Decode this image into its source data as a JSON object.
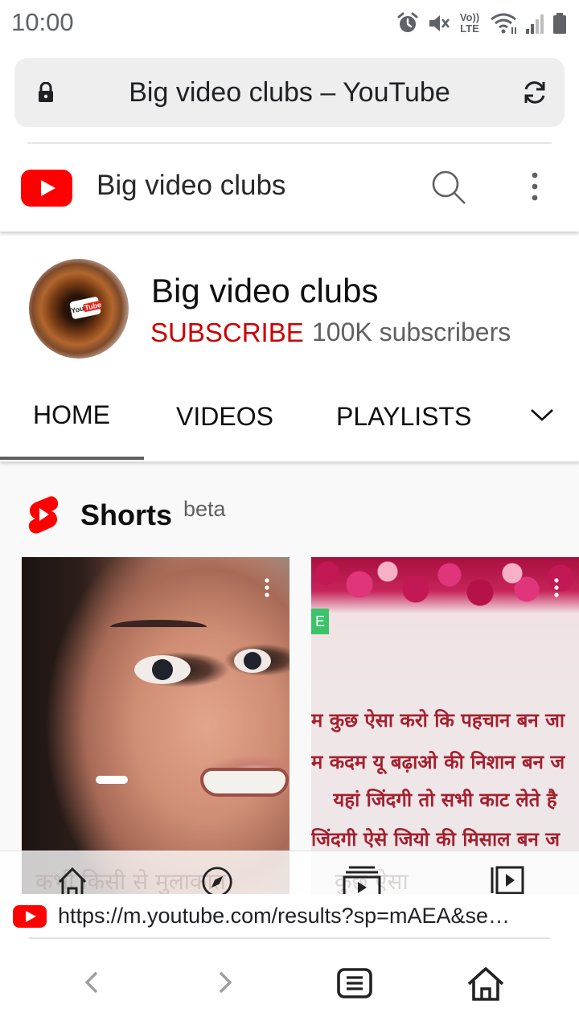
{
  "status_bar": {
    "time": "10:00",
    "lte_label_top": "Vo))",
    "lte_label_bottom": "LTE",
    "icons": [
      "alarm-icon",
      "mute-icon",
      "volte-icon",
      "wifi-icon",
      "signal-icon",
      "battery-icon"
    ]
  },
  "browser": {
    "tab_title": "Big video clubs – YouTube",
    "suggestion_url": "https://m.youtube.com/results?sp=mAEA&se…"
  },
  "header": {
    "channel_title": "Big video clubs"
  },
  "channel": {
    "name": "Big video clubs",
    "subscribe_label": "SUBSCRIBE",
    "subscribers": "100K subscribers",
    "avatar_logo_text": "You",
    "avatar_logo_tube": "Tube"
  },
  "tabs": [
    {
      "label": "HOME",
      "selected": true
    },
    {
      "label": "VIDEOS",
      "selected": false
    },
    {
      "label": "PLAYLISTS",
      "selected": false
    }
  ],
  "shorts": {
    "title": "Shorts",
    "badge": "beta",
    "cards": [
      {
        "caption_faded": "कभी किसी से मुलाकात"
      },
      {
        "side_tab": "E",
        "lines": [
          "म कुछ ऐसा करो कि पहचान बन जा",
          "म कदम यू बढ़ाओ की निशान बन ज",
          "यहां जिंदगी तो सभी काट लेते है",
          "जिंदगी ऐसे जियो की मिसाल बन ज"
        ],
        "caption_faded": "कुछ ऐसा"
      }
    ]
  },
  "colors": {
    "youtube_red": "#ff0000",
    "subscribe_red": "#cc0000",
    "hindi_text": "#a4202e"
  }
}
